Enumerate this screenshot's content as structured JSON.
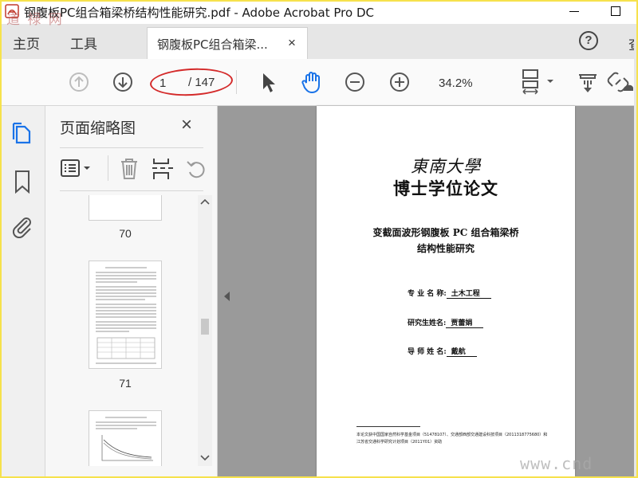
{
  "window": {
    "title": "钢腹板PC组合箱梁桥结构性能研究.pdf - Adobe Acrobat Pro DC"
  },
  "watermark": {
    "top_left": "道 禄 网",
    "bottom_right": "www.cnd"
  },
  "menu": {
    "home": "主页",
    "tools": "工具",
    "search_partial": "查"
  },
  "tab": {
    "label": "钢腹板PC组合箱梁...",
    "close": "×"
  },
  "toolbar": {
    "page_current": "1",
    "page_total": "/ 147",
    "zoom": "34.2%"
  },
  "thumbnails": {
    "title": "页面缩略图",
    "close": "×",
    "pages": [
      {
        "num": "70"
      },
      {
        "num": "71"
      }
    ]
  },
  "document": {
    "university": "東南大學",
    "degree": "博士学位论文",
    "title_line1": "变截面波形钢腹板 PC 组合箱梁桥",
    "title_line2": "结构性能研究",
    "major_label": "专 业 名 称:",
    "major_value": "土木工程",
    "student_label": "研究生姓名:",
    "student_value": "贾蕾娟",
    "advisor_label": "导 师 姓 名:",
    "advisor_value": "戴航",
    "footnote": "本论文获中国国家自然科学基金项目（51478107）、交通部西部交通建设科技项目（2011318775680）和江苏省交通科学研究计划项目（2011Y01）资助"
  }
}
